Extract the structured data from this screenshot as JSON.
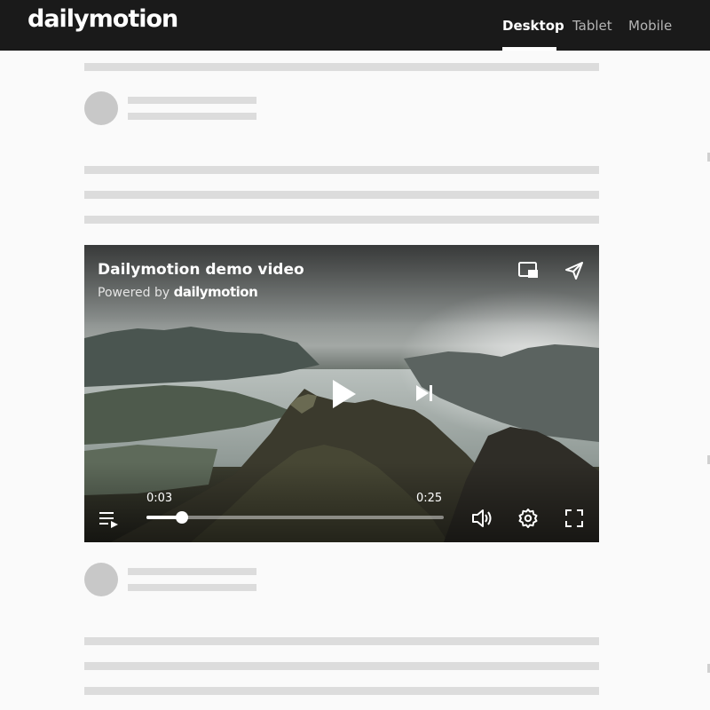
{
  "header": {
    "logo": "dailymotion",
    "nav": [
      {
        "label": "Desktop",
        "active": true
      },
      {
        "label": "Tablet",
        "active": false
      },
      {
        "label": "Mobile",
        "active": false
      }
    ]
  },
  "player": {
    "title": "Dailymotion demo video",
    "powered_by": "Powered by",
    "powered_brand": "dailymotion",
    "current_time": "0:03",
    "duration": "0:25",
    "progress": 0.12,
    "icons": [
      "picture-in-picture-icon",
      "share-icon",
      "play-icon",
      "next-icon",
      "playlist-icon",
      "volume-icon",
      "settings-icon",
      "fullscreen-icon"
    ]
  },
  "colors": {
    "header_bg": "#1a1a1a",
    "page_bg": "#fafafa",
    "skeleton": "#dcdcdc",
    "avatar": "#c8c8c8"
  }
}
